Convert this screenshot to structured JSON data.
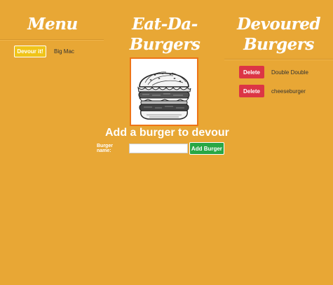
{
  "menu": {
    "title": "Menu",
    "items": [
      {
        "button_label": "Devour it!",
        "name": "Big Mac"
      }
    ]
  },
  "center": {
    "title_line1": "Eat-Da-",
    "title_line2": "Burgers",
    "image_icon": "burger-illustration",
    "add_heading": "Add a burger to devour",
    "form": {
      "label": "Burger name:",
      "input_value": "",
      "submit_label": "Add Burger"
    }
  },
  "devoured": {
    "title_line1": "Devoured",
    "title_line2": "Burgers",
    "items": [
      {
        "button_label": "Delete",
        "name": "Double Double"
      },
      {
        "button_label": "Delete",
        "name": "cheeseburger"
      }
    ]
  },
  "colors": {
    "background": "#E8A735",
    "devour_button": "#F0C419",
    "delete_button": "#DC3545",
    "add_button": "#28A745",
    "image_border": "#EE7416"
  }
}
